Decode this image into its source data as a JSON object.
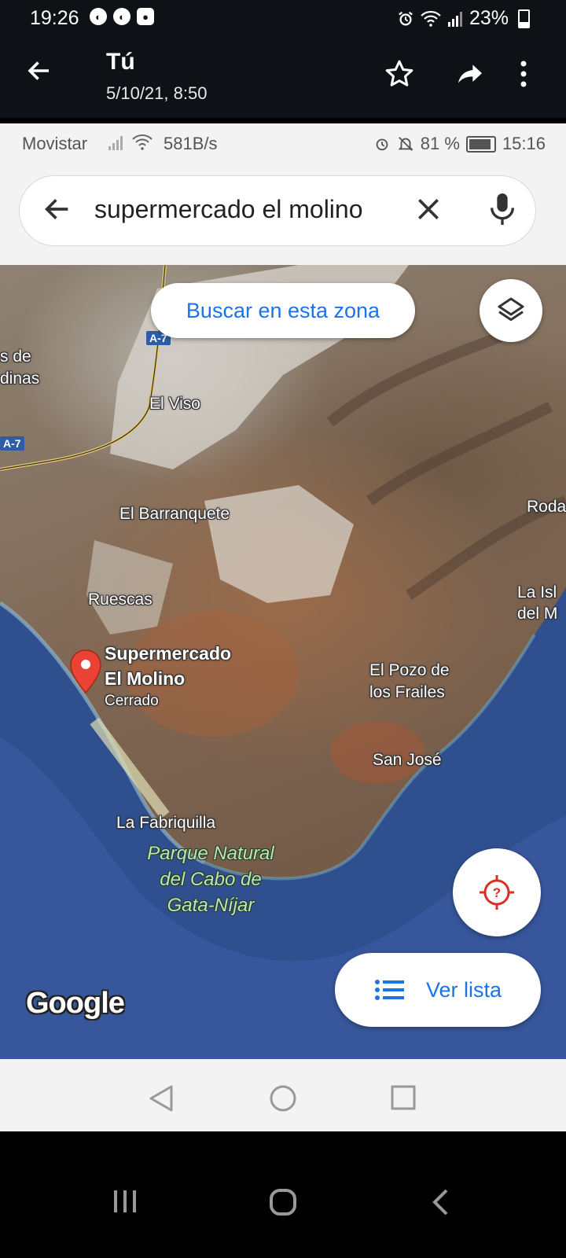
{
  "outer_status": {
    "time": "19:26",
    "battery": "23%",
    "notif_icons": [
      "carrefour-icon",
      "carrefour-icon",
      "camera-icon"
    ]
  },
  "appbar": {
    "back_icon": "arrow-back-icon",
    "title": "Tú",
    "subtitle": "5/10/21, 8:50",
    "actions": [
      "star-icon",
      "share-icon",
      "more-vert-icon"
    ]
  },
  "screenshot": {
    "status": {
      "carrier": "Movistar",
      "speed": "581B/s",
      "battery": "81 %",
      "time": "15:16"
    },
    "search": {
      "query": "supermercado el molino"
    },
    "map": {
      "search_area_button": "Buscar en esta zona",
      "list_button": "Ver lista",
      "logo": "Google",
      "road_labels": [
        "A-7",
        "A-7"
      ],
      "places": {
        "left_top_1": "s de",
        "left_top_2": "dinas",
        "el_viso": "El Viso",
        "el_barranquete": "El Barranquete",
        "ruescas": "Ruescas",
        "el_pozo_1": "El Pozo de",
        "el_pozo_2": "los Frailes",
        "san_jose": "San José",
        "la_fabriquilla": "La Fabriquilla",
        "roda": "Roda",
        "la_isleta_1": "La Isl",
        "la_isleta_2": "del M"
      },
      "park": [
        "Parque Natural",
        "del Cabo de",
        "Gata-Níjar"
      ],
      "marker": {
        "name_line1": "Supermercado",
        "name_line2": "El Molino",
        "status": "Cerrado",
        "color": "#ea4335"
      }
    }
  },
  "colors": {
    "accent": "#1a73e8",
    "appbar_bg": "#0e1217",
    "sea": "#2f4f8f"
  }
}
